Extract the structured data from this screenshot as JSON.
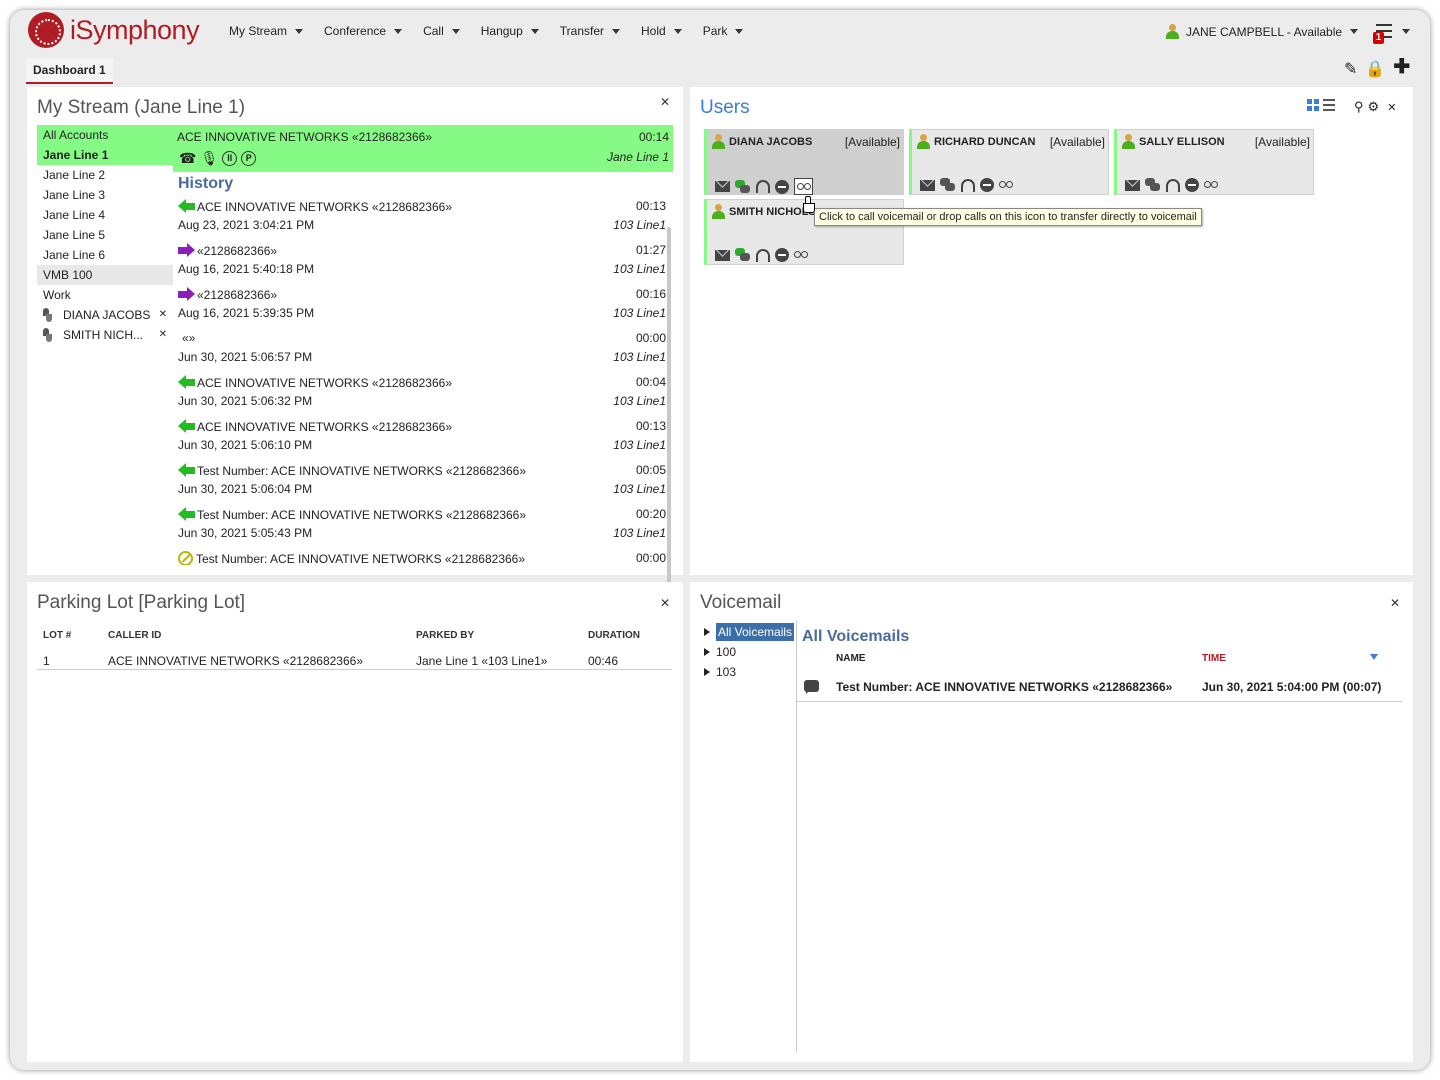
{
  "app": {
    "name": "iSymphony"
  },
  "menu": [
    {
      "label": "My Stream"
    },
    {
      "label": "Conference"
    },
    {
      "label": "Call"
    },
    {
      "label": "Hangup"
    },
    {
      "label": "Transfer"
    },
    {
      "label": "Hold"
    },
    {
      "label": "Park"
    }
  ],
  "user": {
    "name_status": "JANE CAMPBELL - Available",
    "notification_count": "1"
  },
  "tabs": [
    {
      "label": "Dashboard 1"
    }
  ],
  "stream": {
    "title": "My Stream (Jane Line 1)",
    "accounts": [
      {
        "label": "All Accounts"
      },
      {
        "label": "Jane Line 1"
      },
      {
        "label": "Jane Line 2"
      },
      {
        "label": "Jane Line 3"
      },
      {
        "label": "Jane Line 4"
      },
      {
        "label": "Jane Line 5"
      },
      {
        "label": "Jane Line 6"
      },
      {
        "label": "VMB 100"
      },
      {
        "label": "Work"
      },
      {
        "label": "DIANA JACOBS"
      },
      {
        "label": "SMITH NICH..."
      }
    ],
    "active_call": {
      "name": "ACE INNOVATIVE NETWORKS «2128682366»",
      "duration": "00:14",
      "line": "Jane Line 1"
    },
    "history_title": "History",
    "history": [
      {
        "name": "ACE INNOVATIVE NETWORKS «2128682366»",
        "date": "Aug 23, 2021 3:04:21 PM",
        "duration": "00:13",
        "line": "103 Line1",
        "dir": "in"
      },
      {
        "name": "«2128682366»",
        "date": "Aug 16, 2021 5:40:18 PM",
        "duration": "01:27",
        "line": "103 Line1",
        "dir": "out"
      },
      {
        "name": "«2128682366»",
        "date": "Aug 16, 2021 5:39:35 PM",
        "duration": "00:16",
        "line": "103 Line1",
        "dir": "out"
      },
      {
        "name": "«»",
        "date": "Jun 30, 2021 5:06:57 PM",
        "duration": "00:00",
        "line": "103 Line1",
        "dir": "none"
      },
      {
        "name": "ACE INNOVATIVE NETWORKS «2128682366»",
        "date": "Jun 30, 2021 5:06:32 PM",
        "duration": "00:04",
        "line": "103 Line1",
        "dir": "in"
      },
      {
        "name": "ACE INNOVATIVE NETWORKS «2128682366»",
        "date": "Jun 30, 2021 5:06:10 PM",
        "duration": "00:13",
        "line": "103 Line1",
        "dir": "in"
      },
      {
        "name": "Test Number: ACE INNOVATIVE NETWORKS «2128682366»",
        "date": "Jun 30, 2021 5:06:04 PM",
        "duration": "00:05",
        "line": "103 Line1",
        "dir": "in"
      },
      {
        "name": "Test Number: ACE INNOVATIVE NETWORKS «2128682366»",
        "date": "Jun 30, 2021 5:05:43 PM",
        "duration": "00:20",
        "line": "103 Line1",
        "dir": "in"
      },
      {
        "name": "Test Number: ACE INNOVATIVE NETWORKS «2128682366»",
        "date": "",
        "duration": "00:00",
        "line": "",
        "dir": "missed"
      }
    ]
  },
  "users": {
    "title": "Users",
    "cards": [
      {
        "name": "DIANA JACOBS",
        "status": "[Available]"
      },
      {
        "name": "RICHARD DUNCAN",
        "status": "[Available]"
      },
      {
        "name": "SALLY ELLISON",
        "status": "[Available]"
      },
      {
        "name": "SMITH NICHOLS",
        "status": ""
      }
    ],
    "tooltip": "Click to call voicemail or drop calls on this icon to transfer directly to voicemail"
  },
  "parking": {
    "title": "Parking Lot [Parking Lot]",
    "columns": {
      "lot": "LOT #",
      "caller": "CALLER ID",
      "parked_by": "PARKED BY",
      "duration": "DURATION"
    },
    "rows": [
      {
        "lot": "1",
        "caller": "ACE INNOVATIVE NETWORKS «2128682366»",
        "parked_by": "Jane Line 1 «103 Line1»",
        "duration": "00:46"
      }
    ]
  },
  "voicemail": {
    "title": "Voicemail",
    "tree": [
      {
        "label": "All Voicemails"
      },
      {
        "label": "100"
      },
      {
        "label": "103"
      }
    ],
    "list_title": "All Voicemails",
    "columns": {
      "name": "NAME",
      "time": "TIME"
    },
    "time_color": "#b01c24",
    "rows": [
      {
        "name": "Test Number: ACE INNOVATIVE NETWORKS «2128682366»",
        "time": "Jun 30, 2021 5:04:00 PM (00:07)"
      }
    ]
  },
  "colors": {
    "brand": "#b01c24",
    "active_green": "#85fb85",
    "heading_blue": "#4a6b9a",
    "link_blue": "#3a7fd5"
  }
}
